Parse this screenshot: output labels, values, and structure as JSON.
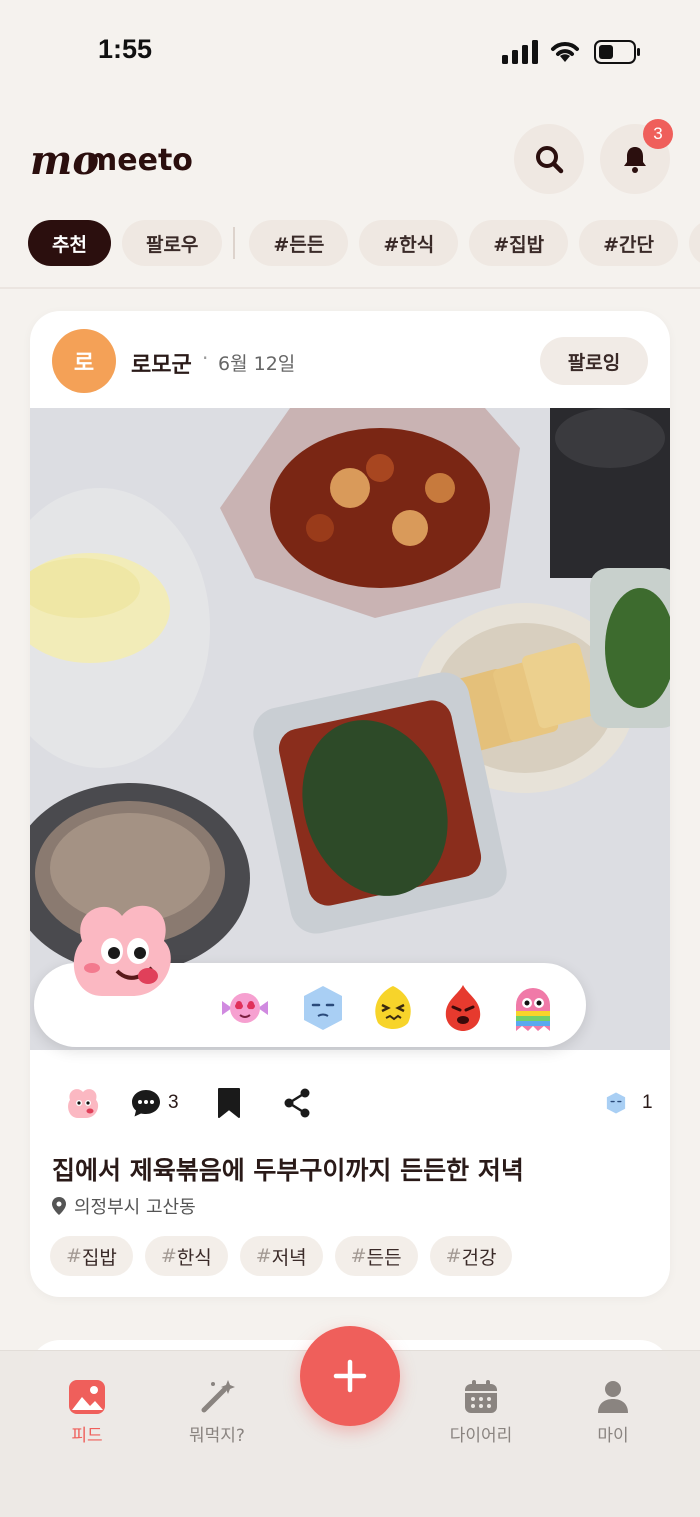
{
  "status_bar": {
    "time": "1:55"
  },
  "header": {
    "logo_text": "momeeto",
    "notification_count": "3"
  },
  "chips": [
    {
      "label": "추천",
      "active": true
    },
    {
      "label": "팔로우",
      "active": false
    },
    {
      "label": "#든든",
      "active": false
    },
    {
      "label": "#한식",
      "active": false
    },
    {
      "label": "#집밥",
      "active": false
    },
    {
      "label": "#간단",
      "active": false
    }
  ],
  "post": {
    "avatar_initial": "로",
    "username": "로모군",
    "separator": "·",
    "date": "6월 12일",
    "follow_label": "팔로잉",
    "reactions": [
      "heart-eyes-candy-icon",
      "sleepy-ice-icon",
      "squint-lemon-icon",
      "angry-fire-icon",
      "rainbow-ghost-icon"
    ],
    "comment_count": "3",
    "reaction_count": "1",
    "title": "집에서 제육볶음에 두부구이까지 든든한 저녁",
    "location": "의정부시 고산동",
    "tags": [
      {
        "hash": "#",
        "text": "집밥"
      },
      {
        "hash": "#",
        "text": "한식"
      },
      {
        "hash": "#",
        "text": "저녁"
      },
      {
        "hash": "#",
        "text": "든든"
      },
      {
        "hash": "#",
        "text": "건강"
      }
    ]
  },
  "bottom_nav": {
    "feed": "피드",
    "what_to_eat": "뭐먹지?",
    "diary": "다이어리",
    "my": "마이"
  },
  "colors": {
    "accent": "#ef5f5b",
    "chip_active": "#2b0f0e",
    "background": "#f5f2ee"
  }
}
